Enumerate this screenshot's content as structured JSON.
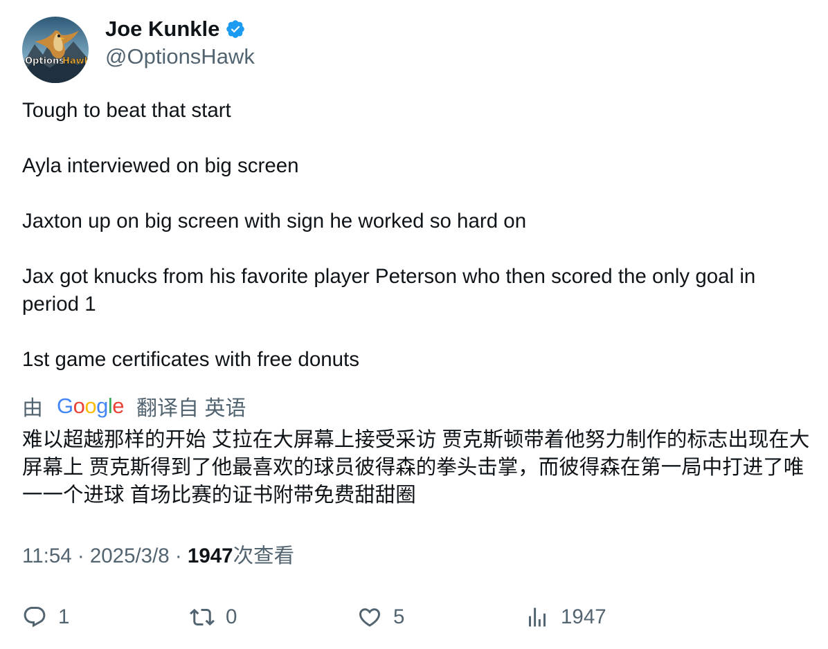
{
  "author": {
    "display_name": "Joe Kunkle",
    "handle": "@OptionsHawk",
    "avatar_text_left": "Options",
    "avatar_text_right": "Hawk"
  },
  "tweet": {
    "paragraphs": [
      "Tough to beat that start",
      "Ayla interviewed on big screen",
      "Jaxton up on big screen with sign he worked so hard on",
      "Jax got knucks from his favorite player Peterson who then scored the only goal in period 1",
      "1st game certificates with free donuts"
    ]
  },
  "translation": {
    "prefix": "由",
    "provider": "Google",
    "suffix": "翻译自 英语",
    "text": "难以超越那样的开始 艾拉在大屏幕上接受采访 贾克斯顿带着他努力制作的标志出现在大屏幕上 贾克斯得到了他最喜欢的球员彼得森的拳头击掌，而彼得森在第一局中打进了唯一一个进球 首场比赛的证书附带免费甜甜圈"
  },
  "meta": {
    "time": "11:54",
    "separator": " · ",
    "date": "2025/3/8",
    "views_count": "1947",
    "views_label": "次查看"
  },
  "actions": {
    "reply_count": "1",
    "retweet_count": "0",
    "like_count": "5",
    "views_count": "1947"
  },
  "colors": {
    "text_primary": "#0f1419",
    "text_secondary": "#536471",
    "verified_blue": "#1d9bf0"
  },
  "icons": {
    "verified": "verified-badge-icon",
    "reply": "reply-icon",
    "retweet": "retweet-icon",
    "like": "heart-icon",
    "views": "bar-chart-icon"
  }
}
